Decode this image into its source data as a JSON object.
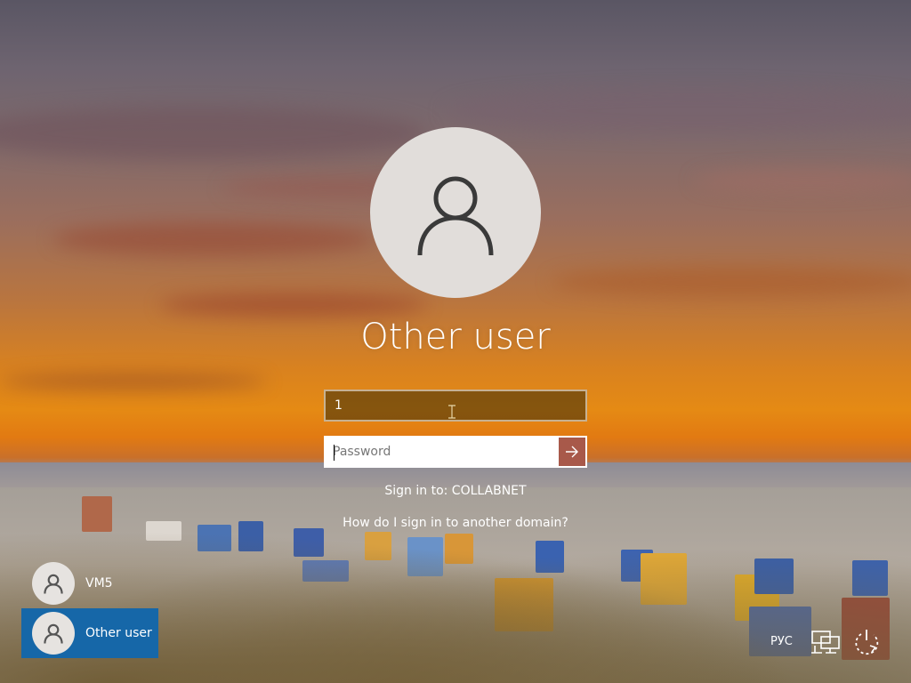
{
  "login": {
    "username_title": "Other user",
    "username_value": "1",
    "password_placeholder": "Password",
    "sign_in_to": "Sign in to: COLLABNET",
    "domain_help_link": "How do I sign in to another domain?"
  },
  "user_list": [
    {
      "name": "VM5",
      "selected": false
    },
    {
      "name": "Other user",
      "selected": true
    }
  ],
  "tray": {
    "language": "РУС",
    "network_icon": "network-icon",
    "power_icon": "power-icon"
  },
  "colors": {
    "selected_tile": "#1667a8",
    "submit_button": "#a8594a",
    "avatar_bg": "#e1ddda"
  }
}
